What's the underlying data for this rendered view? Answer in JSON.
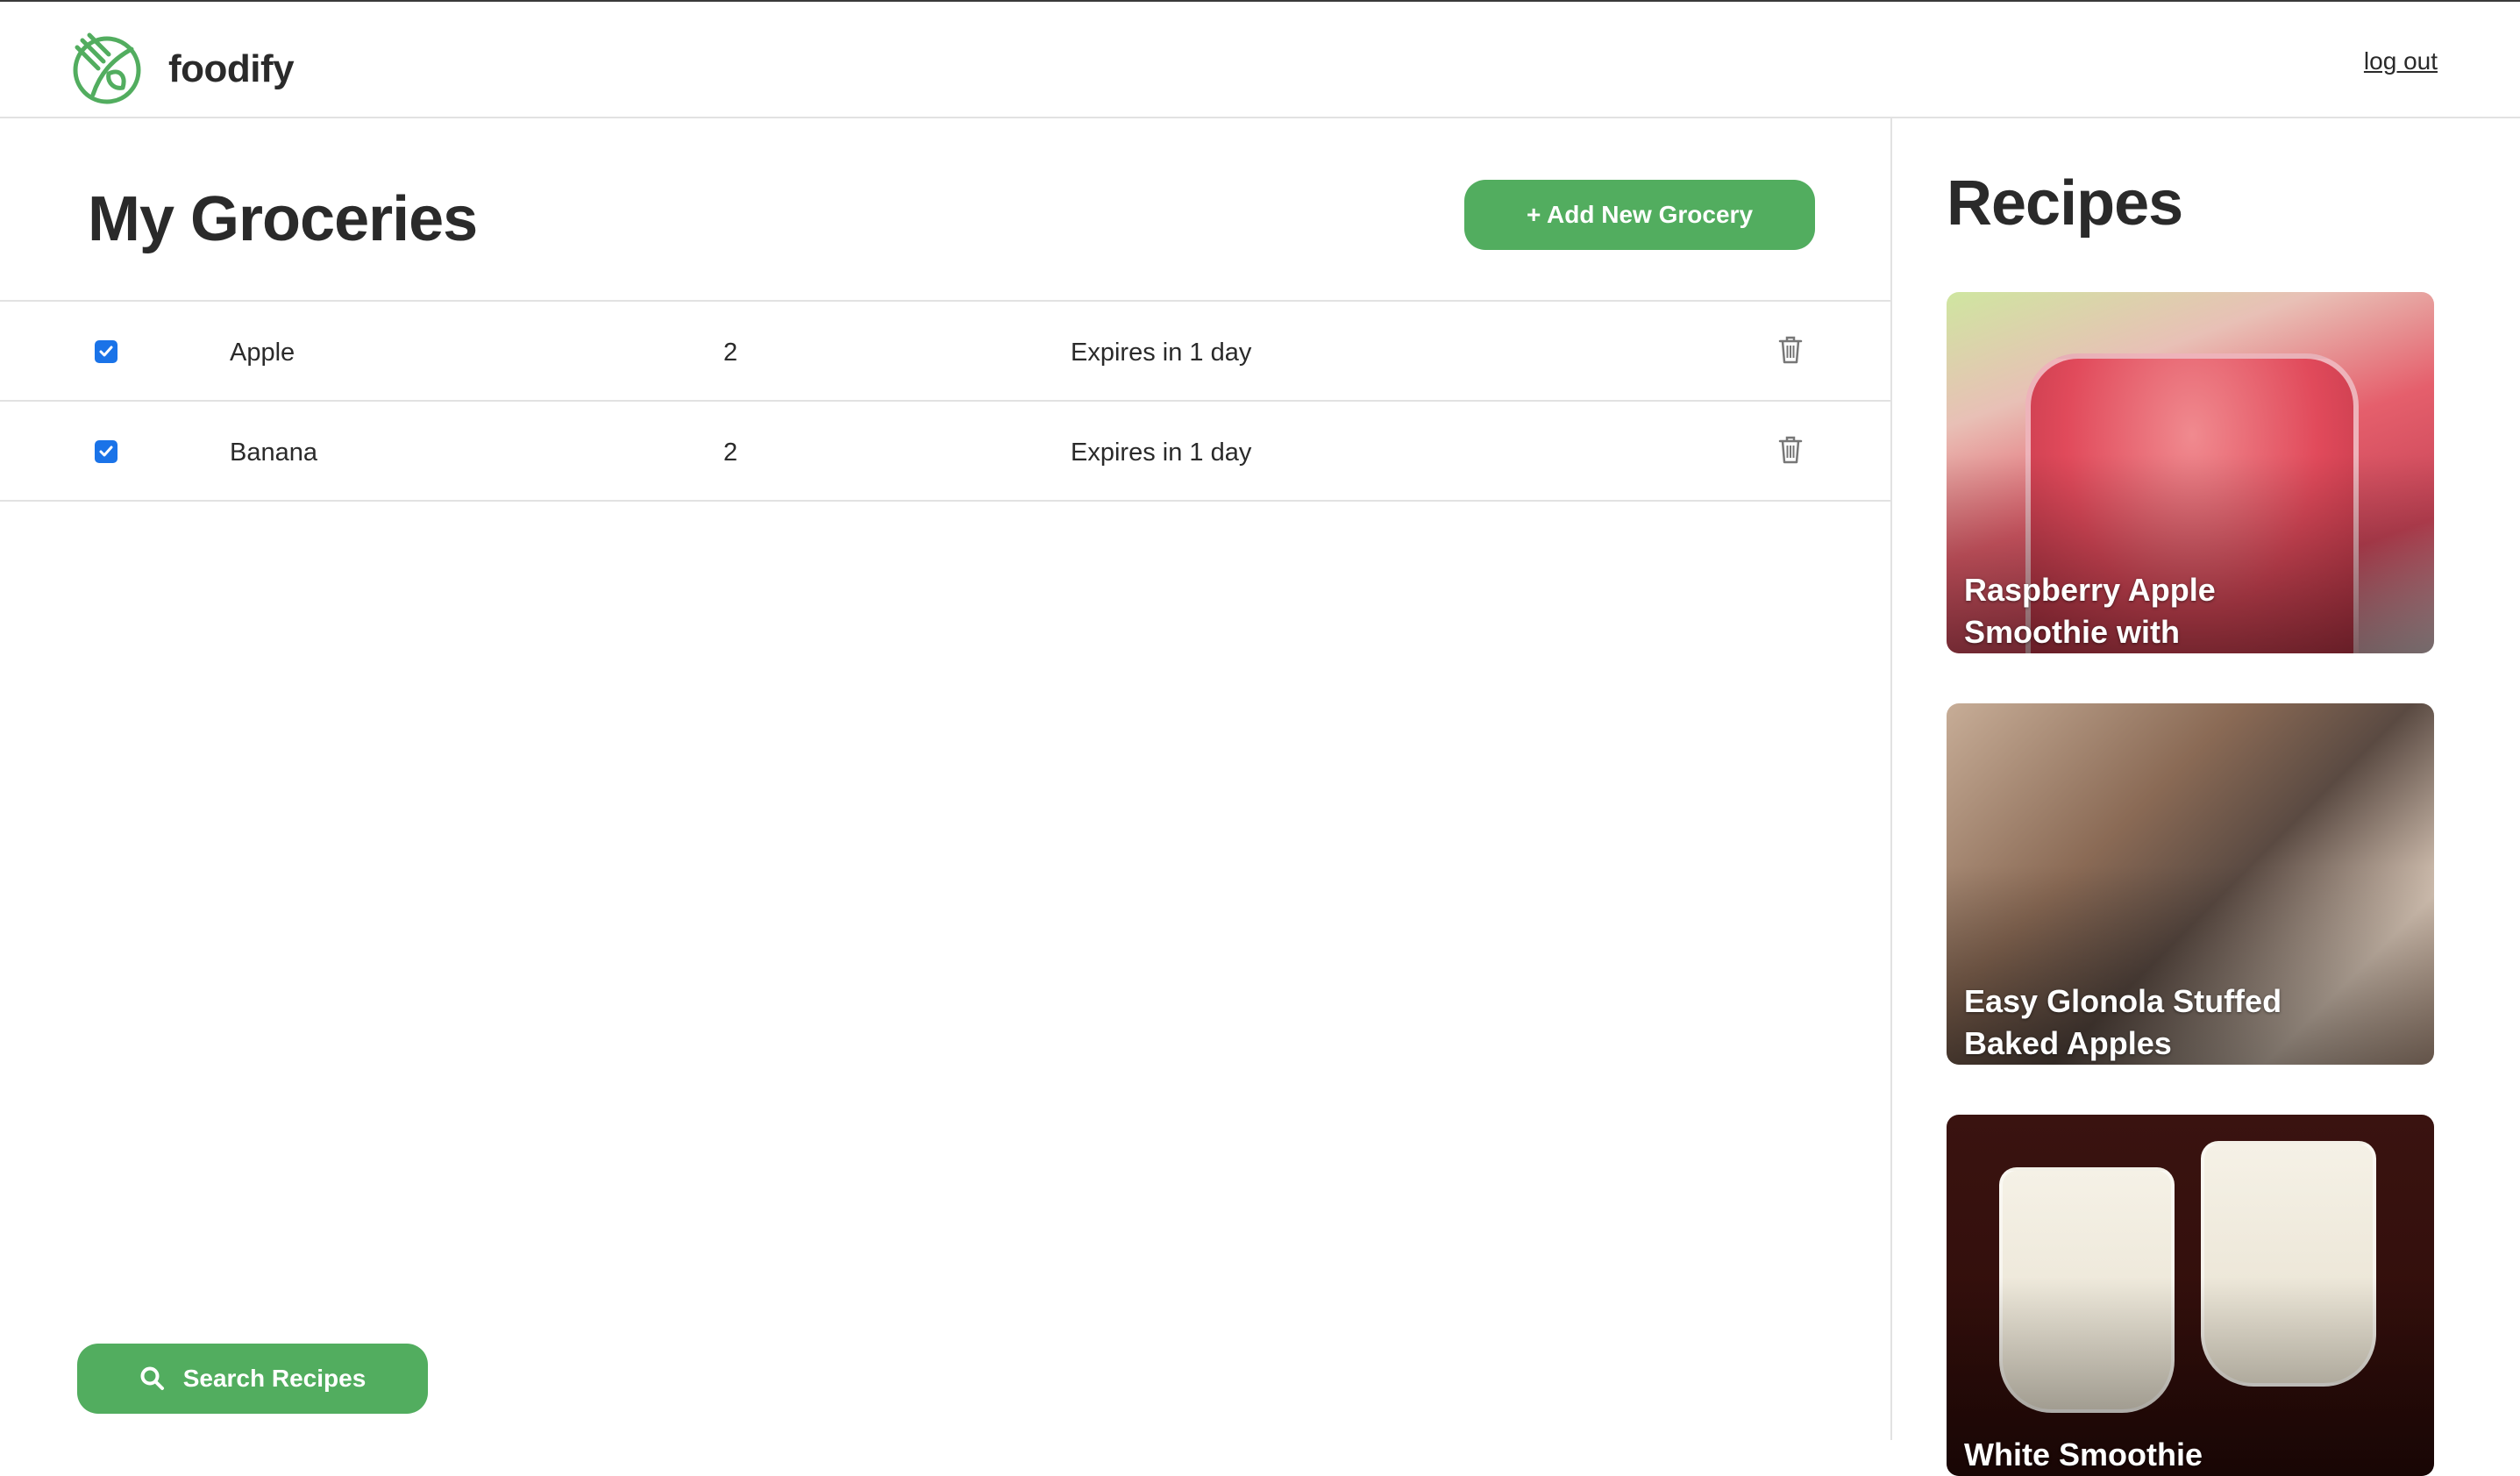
{
  "app": {
    "brand": "foodify",
    "logout_label": "log out",
    "accent_color": "#52ad5f"
  },
  "groceries": {
    "title": "My Groceries",
    "add_button_label": "+ Add New Grocery",
    "items": [
      {
        "checked": true,
        "name": "Apple",
        "quantity": "2",
        "expiry": "Expires in 1 day"
      },
      {
        "checked": true,
        "name": "Banana",
        "quantity": "2",
        "expiry": "Expires in 1 day"
      }
    ],
    "search_button_label": "Search Recipes",
    "search_icon": "search-icon",
    "delete_icon": "trash-icon"
  },
  "recipes": {
    "title": "Recipes",
    "cards": [
      {
        "title": "Raspberry Apple Smoothie with"
      },
      {
        "title": "Easy Glonola Stuffed Baked Apples"
      },
      {
        "title": "White Smoothie"
      }
    ]
  }
}
